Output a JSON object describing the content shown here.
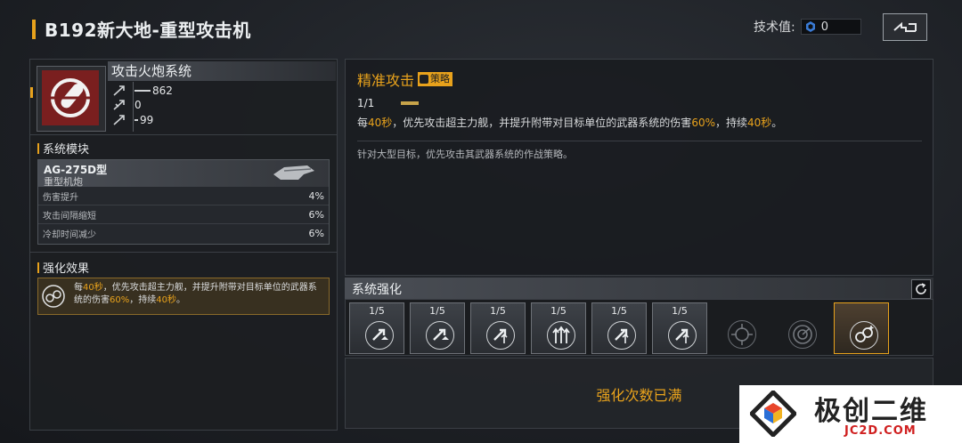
{
  "header": {
    "title": "B192新大地-重型攻击机",
    "tech_label": "技术值:",
    "tech_value": "0",
    "back_icon": "back-icon"
  },
  "system": {
    "name": "攻击火炮系统",
    "stats": [
      {
        "icon": "damage-icon",
        "value": "862"
      },
      {
        "icon": "penetration-icon",
        "value": "0"
      },
      {
        "icon": "hit-rate-icon",
        "value": "99"
      }
    ]
  },
  "modules": {
    "title": "系统模块",
    "name": "AG-275D型",
    "type": "重型机炮",
    "rows": [
      {
        "label": "伤害提升",
        "value": "4%"
      },
      {
        "label": "攻击间隔缩短",
        "value": "6%"
      },
      {
        "label": "冷却时间减少",
        "value": "6%"
      }
    ]
  },
  "effect": {
    "title": "强化效果",
    "text_parts": [
      "每",
      "40秒",
      "，优先攻击超主力舰，并提升附带对目标单位的武器系统的伤害",
      "60%",
      "，持续",
      "40秒",
      "。"
    ]
  },
  "skill": {
    "title": "精准攻击",
    "badge": "策略",
    "level": "1/1",
    "desc_parts": [
      "每",
      "40秒",
      "，优先攻击超主力舰，并提升附带对目标单位的武器系统的伤害",
      "60%",
      "，持续",
      "40秒",
      "。"
    ],
    "note": "针对大型目标，优先攻击其武器系统的作战策略。"
  },
  "enhance": {
    "title": "系统强化",
    "slots": [
      {
        "count": "1/5",
        "icon": "cannon-up-icon"
      },
      {
        "count": "1/5",
        "icon": "cannon-up-icon"
      },
      {
        "count": "1/5",
        "icon": "cannon-up-icon"
      },
      {
        "count": "1/5",
        "icon": "triple-arrow-icon"
      },
      {
        "count": "1/5",
        "icon": "cannon-up-icon"
      },
      {
        "count": "1/5",
        "icon": "cannon-up-icon"
      },
      {
        "count": "",
        "icon": "target-locked-icon"
      },
      {
        "count": "",
        "icon": "radar-locked-icon"
      },
      {
        "count": "",
        "icon": "gear-boost-icon"
      }
    ],
    "status": "强化次数已满"
  },
  "watermark": {
    "cn": "极创二维",
    "en": "JC2D.COM"
  },
  "colors": {
    "accent": "#e8a21c",
    "panel": "#1c1f24"
  }
}
